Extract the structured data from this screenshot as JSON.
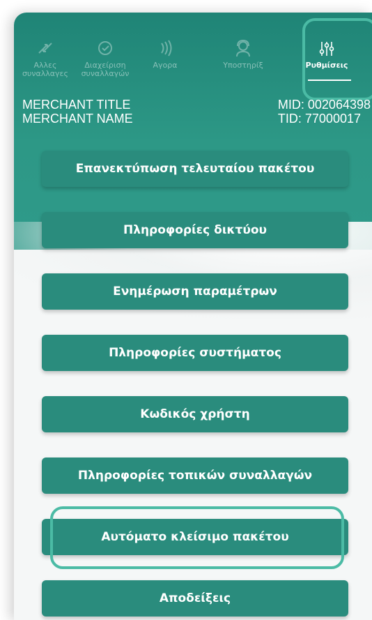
{
  "nav": {
    "items": [
      {
        "label": "Αλλες\nσυναλλαγες",
        "icon": "transactions-icon"
      },
      {
        "label": "Διαχείριση\nσυναλλαγών",
        "icon": "manage-icon"
      },
      {
        "label": "Αγορα",
        "icon": "contactless-icon"
      },
      {
        "label": "Υποστηρίξ",
        "icon": "support-agent-icon"
      },
      {
        "label": "Ρυθμίσεις",
        "icon": "settings-sliders-icon",
        "active": true
      }
    ]
  },
  "merchant": {
    "title": "MERCHANT TITLE",
    "name": "MERCHANT NAME",
    "mid": "MID: 002064398",
    "tid": "TID: 77000017"
  },
  "menu": {
    "buttons": [
      "Επανεκτύπωση τελευταίου πακέτου",
      "Πληροφορίες δικτύου",
      "Ενημέρωση παραμέτρων",
      "Πληροφορίες συστήματος",
      "Κωδικός χρήστη",
      "Πληροφορίες τοπικών συναλλαγών",
      "Αυτόματο κλείσιμο πακέτου",
      "Αποδείξεις"
    ]
  },
  "colors": {
    "primary": "#2a8c7d",
    "header": "#1f8476",
    "highlight": "#4bbba5"
  }
}
